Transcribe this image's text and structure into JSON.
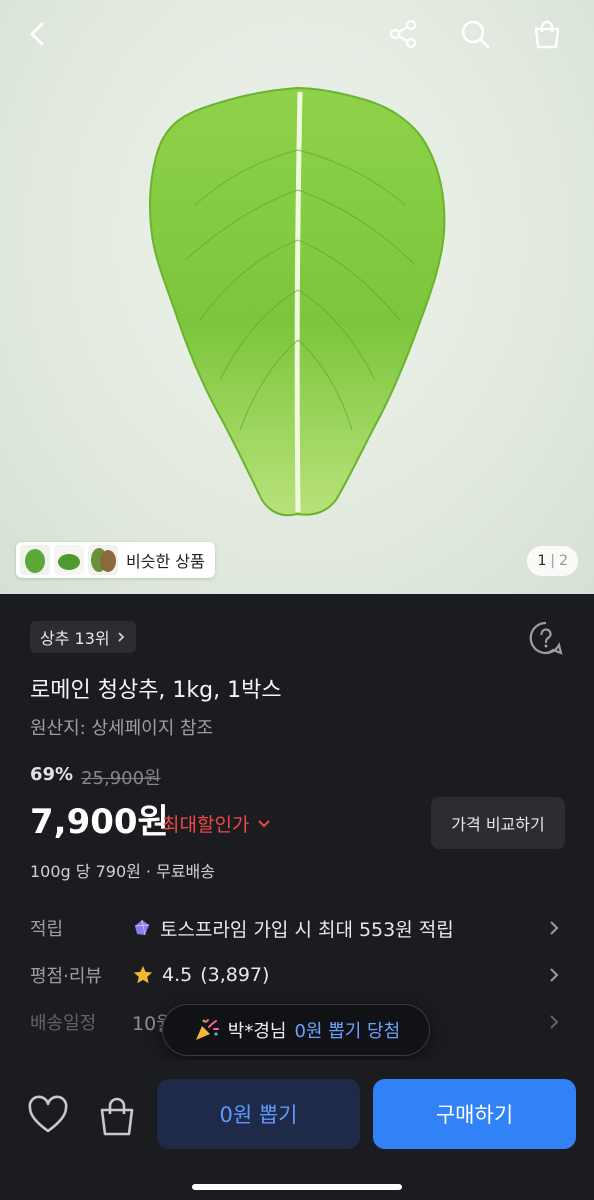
{
  "header": {
    "back_icon": "chevron-left-icon",
    "share_icon": "share-icon",
    "search_icon": "search-icon",
    "cart_icon": "shopping-bag-icon"
  },
  "gallery": {
    "similar_label": "비슷한 상품",
    "current_page": "1",
    "separator": "|",
    "total_pages": "2"
  },
  "product": {
    "rank_label": "상추 13위",
    "title": "로메인 청상추, 1kg, 1박스",
    "origin": "원산지: 상세페이지 참조",
    "discount_rate": "69%",
    "original_price": "25,900원",
    "price": "7,900원",
    "max_discount_label": "최대할인가",
    "compare_label": "가격 비교하기",
    "unit_price": "100g 당 790원 · 무료배송"
  },
  "info": {
    "points_label": "적립",
    "points_value": "토스프라임 가입 시 최대 553원 적립",
    "rating_label": "평점·리뷰",
    "rating_score": "4.5",
    "rating_count": "(3,897)",
    "delivery_label": "배송일정",
    "delivery_value": "10월"
  },
  "toast": {
    "name": "박*경님",
    "highlight": "0원 뽑기 당첨"
  },
  "bottom": {
    "zero_draw_label": "0원 뽑기",
    "buy_label": "구매하기"
  },
  "colors": {
    "accent_blue": "#3182f6",
    "discount_red": "#f0474a",
    "background": "#1b1c20"
  }
}
